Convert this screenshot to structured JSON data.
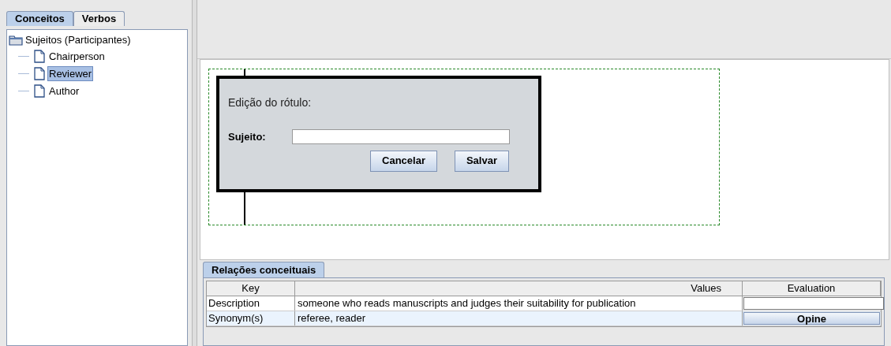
{
  "left_tabs": [
    {
      "label": "Conceitos",
      "selected": true
    },
    {
      "label": "Verbos",
      "selected": false
    }
  ],
  "tree": {
    "label": "Sujeitos (Participantes)",
    "children": [
      {
        "label": "Chairperson",
        "selected": false
      },
      {
        "label": "Reviewer",
        "selected": true
      },
      {
        "label": "Author",
        "selected": false
      }
    ]
  },
  "dialog": {
    "title": "Edição do rótulo:",
    "field_label": "Sujeito:",
    "buttons": [
      "Cancelar",
      "Salvar"
    ]
  },
  "bottom_tabs": [
    {
      "label": "Relações conceituais",
      "selected": true
    }
  ],
  "table": {
    "columns": [
      "Key",
      "Values",
      "Evaluation"
    ],
    "rows": [
      {
        "key": "Description",
        "value": "someone who reads manuscripts and judges their suitability for publication",
        "evaluation": {
          "kind": "field"
        },
        "selected": false
      },
      {
        "key": "Synonym(s)",
        "value": "referee, reader",
        "evaluation": {
          "kind": "button",
          "label": "Opine"
        },
        "selected": true
      }
    ]
  }
}
